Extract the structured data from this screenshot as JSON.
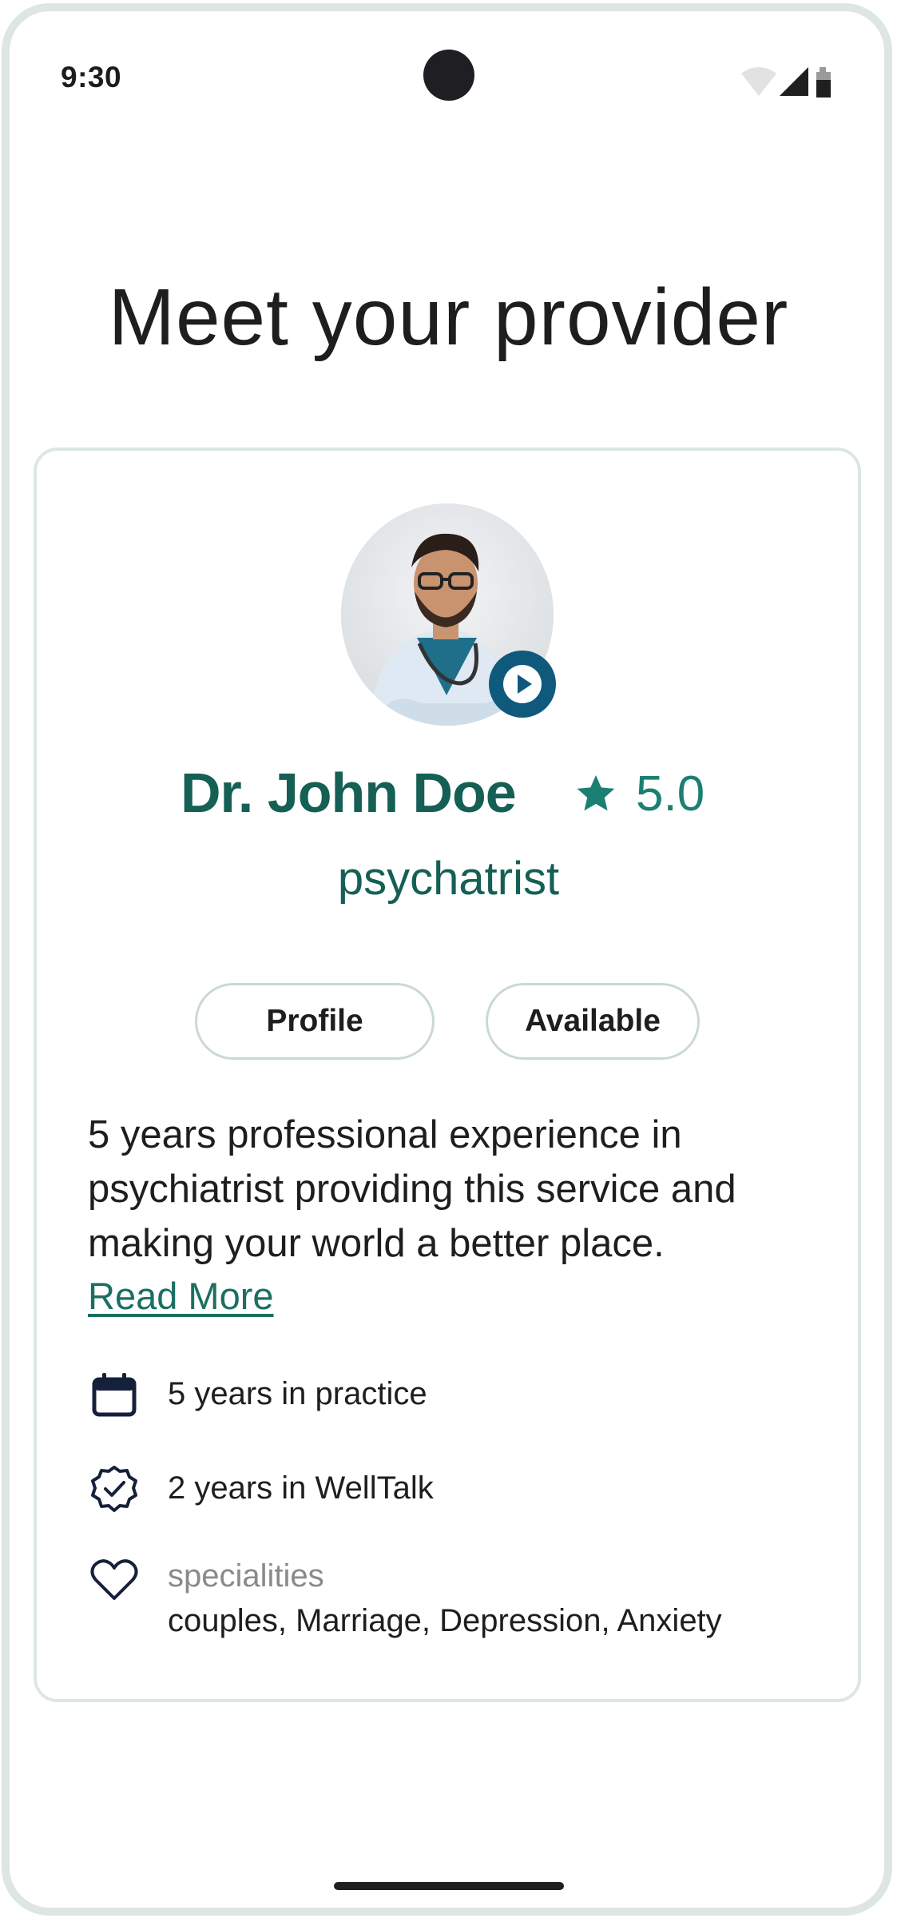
{
  "status_bar": {
    "time": "9:30",
    "icons": [
      "wifi-icon",
      "cell-signal-icon",
      "battery-icon"
    ]
  },
  "page": {
    "title": "Meet your provider"
  },
  "provider": {
    "name": "Dr. John Doe",
    "rating": "5.0",
    "role": "psychatrist",
    "avatar_alt": "provider photo",
    "video_icon": "play-icon"
  },
  "actions": {
    "profile_label": "Profile",
    "available_label": "Available"
  },
  "bio": {
    "text": "5 years professional experience in psychiatrist providing this service and making your world a better place.",
    "read_more": "Read More"
  },
  "details": {
    "practice": {
      "icon": "calendar-icon",
      "text": "5 years in practice"
    },
    "welltalk": {
      "icon": "verified-badge-icon",
      "text": "2 years in WellTalk"
    },
    "specialities": {
      "icon": "heart-icon",
      "label": "specialities",
      "value": "couples, Marriage, Depression, Anxiety"
    }
  },
  "colors": {
    "brand_green": "#155f55",
    "accent_teal": "#1b7f72",
    "play_blue": "#0f5a7c",
    "border": "#dce6e5"
  }
}
